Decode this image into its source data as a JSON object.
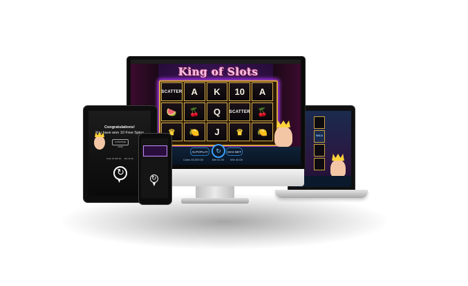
{
  "monitor": {
    "logo": "King of Slots",
    "reels": [
      [
        "SCATTER",
        "A",
        "K",
        "10",
        "A"
      ],
      [
        "🍉",
        "🍒",
        "Q",
        "SCATTER",
        "🍒"
      ],
      [
        "♛",
        "🍋",
        "J",
        "♛",
        "🍋"
      ]
    ],
    "controls": {
      "autoplay": "AUTOPLAY",
      "max_bet": "MAX BET",
      "spin_icon": "refresh-icon"
    },
    "stats": {
      "coins": "Coins 40,000.00",
      "bet": "Bet 41.00",
      "win": "Win 40.00"
    }
  },
  "tablet": {
    "congrats": "Congratulations!",
    "message": "You have won 10 Free Spins",
    "button": "CONTINUE NOW",
    "info_left": "Cash 40,000.00",
    "info_right": "Bet 41.00",
    "rotate_icon": "rotate-device-icon"
  },
  "phone": {
    "rotate_icon": "rotate-device-icon"
  },
  "laptop": {
    "badge": "WILD"
  }
}
